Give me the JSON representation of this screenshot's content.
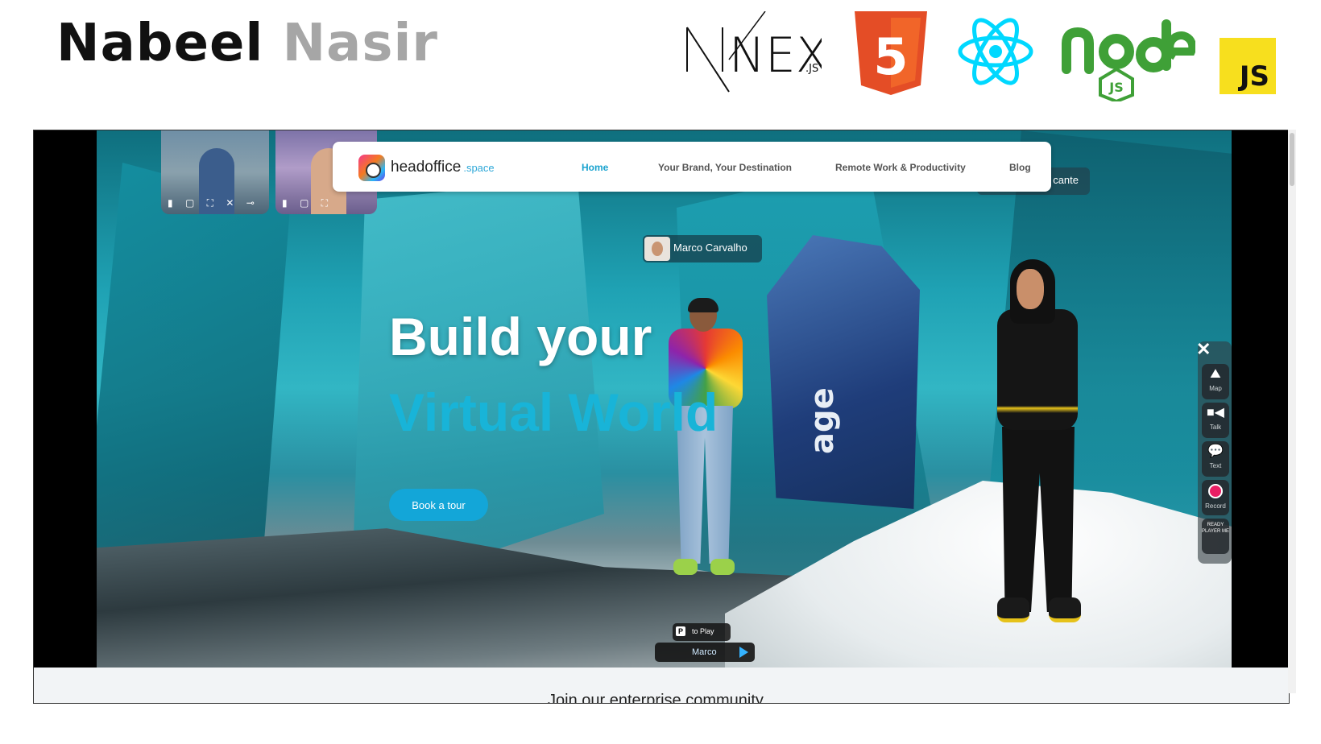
{
  "header": {
    "first_name": "Nabeel",
    "last_name": "Nasir",
    "tech_logos": [
      "NEXT",
      ".JS",
      "5",
      "JS"
    ]
  },
  "site": {
    "brand": "headoffice",
    "brand_suffix": ".space",
    "nav": [
      "Home",
      "Your Brand, Your Destination",
      "Remote Work & Productivity",
      "Blog"
    ]
  },
  "scene": {
    "name_tag_1": "Marco Carvalho",
    "name_tag_2": "cante",
    "monolith_text": "age",
    "hero_line_1": "Build your",
    "hero_line_2": "Virtual World",
    "cta": "Book a tour",
    "side_controls": {
      "map": "Map",
      "talk": "Talk",
      "text": "Text",
      "record": "Record",
      "rpm": "READY PLAYER ME"
    },
    "play_hint": {
      "key": "P",
      "label": "to Play",
      "name": "Marco"
    }
  },
  "bottom_text": "Join our enterprise community",
  "colors": {
    "accent": "#18b4d8",
    "js_yellow": "#f7df1e",
    "html5_orange": "#e44d26",
    "react_cyan": "#00d8ff",
    "node_green": "#3fa037"
  }
}
